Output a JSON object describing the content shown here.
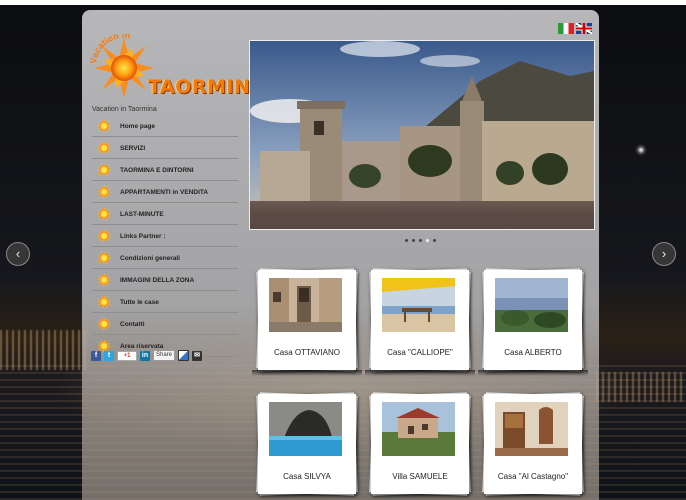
{
  "header": {
    "logo_arc_text": "Vacation in",
    "logo_text": "TAORMINA",
    "tagline": "Vacation in Taormina"
  },
  "languages": [
    {
      "name": "Italiano",
      "icon": "italian-flag-icon"
    },
    {
      "name": "English",
      "icon": "uk-flag-icon"
    }
  ],
  "menu": {
    "items": [
      {
        "label": "Home page"
      },
      {
        "label": "SERVIZI"
      },
      {
        "label": "TAORMINA E DINTORNI"
      },
      {
        "label": "APPARTAMENTI in VENDITA"
      },
      {
        "label": "LAST-MINUTE"
      },
      {
        "label": "Links Partner :"
      },
      {
        "label": "Condizioni generali"
      },
      {
        "label": "IMMAGINI DELLA ZONA"
      },
      {
        "label": "Tutte le case"
      },
      {
        "label": "Contatti"
      },
      {
        "label": "Area riservata"
      }
    ]
  },
  "social": {
    "gplus_label": "+1",
    "share_label": "Share"
  },
  "slideshow": {
    "prev_glyph": "‹",
    "next_glyph": "›",
    "dots": 5,
    "active_dot": 3
  },
  "properties": [
    {
      "name": "Casa OTTAVIANO"
    },
    {
      "name": "Casa \"CALLIOPE\""
    },
    {
      "name": "Casa ALBERTO"
    },
    {
      "name": "Casa SILVYA"
    },
    {
      "name": "Villa SAMUELE"
    },
    {
      "name": "Casa \"Al Castagno\""
    }
  ],
  "colors": {
    "accent": "#f07a10",
    "menu_text": "#222222",
    "panel": "#bdbdbf"
  }
}
